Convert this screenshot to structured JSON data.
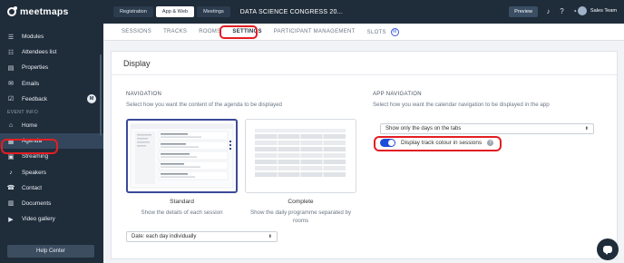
{
  "brand": {
    "name": "meetmaps"
  },
  "sidebar": {
    "items_top": [
      {
        "label": "Modules",
        "icon": "menu-icon"
      },
      {
        "label": "Attendees list",
        "icon": "list-icon"
      },
      {
        "label": "Properties",
        "icon": "properties-icon"
      },
      {
        "label": "Emails",
        "icon": "mail-icon"
      },
      {
        "label": "Feedback",
        "icon": "feedback-icon",
        "badge": "M"
      }
    ],
    "section_label": "EVENT INFO",
    "items_event": [
      {
        "label": "Home",
        "icon": "home-icon"
      },
      {
        "label": "Agenda",
        "icon": "calendar-icon"
      },
      {
        "label": "Streaming",
        "icon": "streaming-icon"
      },
      {
        "label": "Speakers",
        "icon": "microphone-icon"
      },
      {
        "label": "Contact",
        "icon": "contact-icon"
      },
      {
        "label": "Documents",
        "icon": "documents-icon"
      },
      {
        "label": "Video gallery",
        "icon": "video-icon"
      }
    ],
    "help_label": "Help Center"
  },
  "topbar": {
    "tabs": [
      {
        "label": "Registration",
        "active": false
      },
      {
        "label": "App & Web",
        "active": true
      },
      {
        "label": "Meetings",
        "active": false
      }
    ],
    "event_name": "DATA SCIENCE CONGRESS 20...",
    "preview_label": "Preview",
    "user_name": "Sales Team"
  },
  "subtabs": [
    {
      "label": "SESSIONS",
      "active": false
    },
    {
      "label": "TRACKS",
      "active": false
    },
    {
      "label": "ROOMS",
      "active": false
    },
    {
      "label": "SETTINGS",
      "active": true
    },
    {
      "label": "PARTICIPANT MANAGEMENT",
      "active": false
    },
    {
      "label": "SLOTS",
      "active": false,
      "badge": "M"
    }
  ],
  "display": {
    "title": "Display",
    "navigation": {
      "title": "NAVIGATION",
      "description": "Select how you want the content of the agenda to be displayed",
      "options": [
        {
          "label": "Standard",
          "description": "Show the details of each session",
          "selected": true
        },
        {
          "label": "Complete",
          "description": "Show the daily programme separated by rooms",
          "selected": false
        }
      ],
      "date_select": "Date: each day individually"
    },
    "app_navigation": {
      "title": "APP NAVIGATION",
      "description": "Select how you want the calendar navigation to be displayed in the app",
      "select_value": "Show only the days on the tabs",
      "toggle_label": "Display track colour in sessions",
      "toggle_on": true
    }
  },
  "colors": {
    "sidebar_bg": "#1f2c3a",
    "accent_blue": "#1d4ed8",
    "highlight_red": "#e31e24"
  }
}
